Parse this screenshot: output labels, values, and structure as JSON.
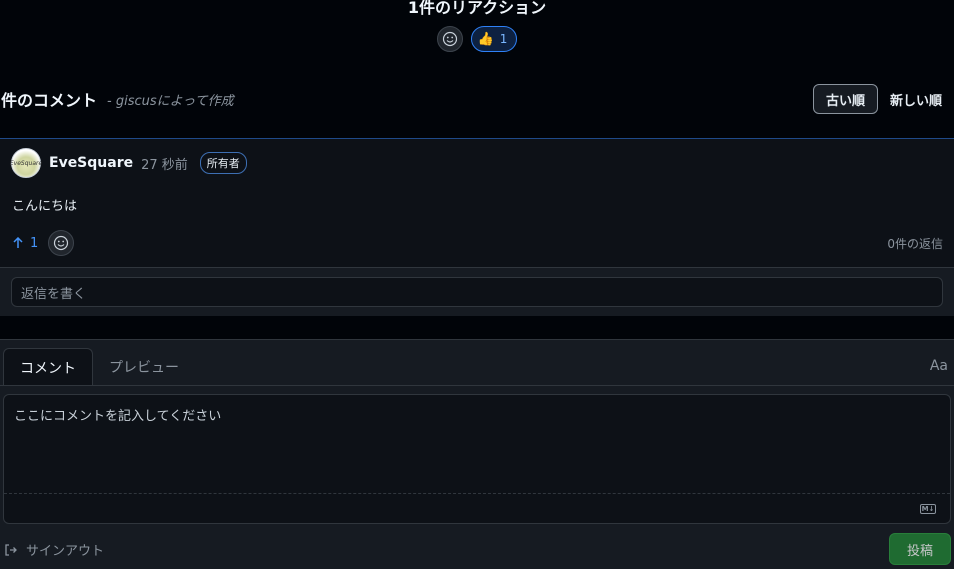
{
  "reactions": {
    "title": "1件のリアクション",
    "thumbs_emoji": "👍",
    "thumbs_count": "1"
  },
  "comments_header": {
    "count_label": "件のコメント",
    "powered_by": "- giscusによって作成",
    "sort_oldest": "古い順",
    "sort_newest": "新しい順"
  },
  "comment": {
    "avatar_text": "EveSquare",
    "author": "EveSquare",
    "time": "27 秒前",
    "owner_badge": "所有者",
    "body": "こんにちは",
    "upvote_count": "1",
    "reply_count": "0件の返信",
    "reply_placeholder": "返信を書く"
  },
  "editor": {
    "tab_comment": "コメント",
    "tab_preview": "プレビュー",
    "font_toggle": "Aa",
    "placeholder": "ここにコメントを記入してください",
    "markdown_badge": "M↓",
    "signout_label": "サインアウト",
    "post_label": "投稿"
  },
  "colors": {
    "background": "#010409",
    "accent_blue": "#4493f8",
    "post_green": "#238636"
  }
}
